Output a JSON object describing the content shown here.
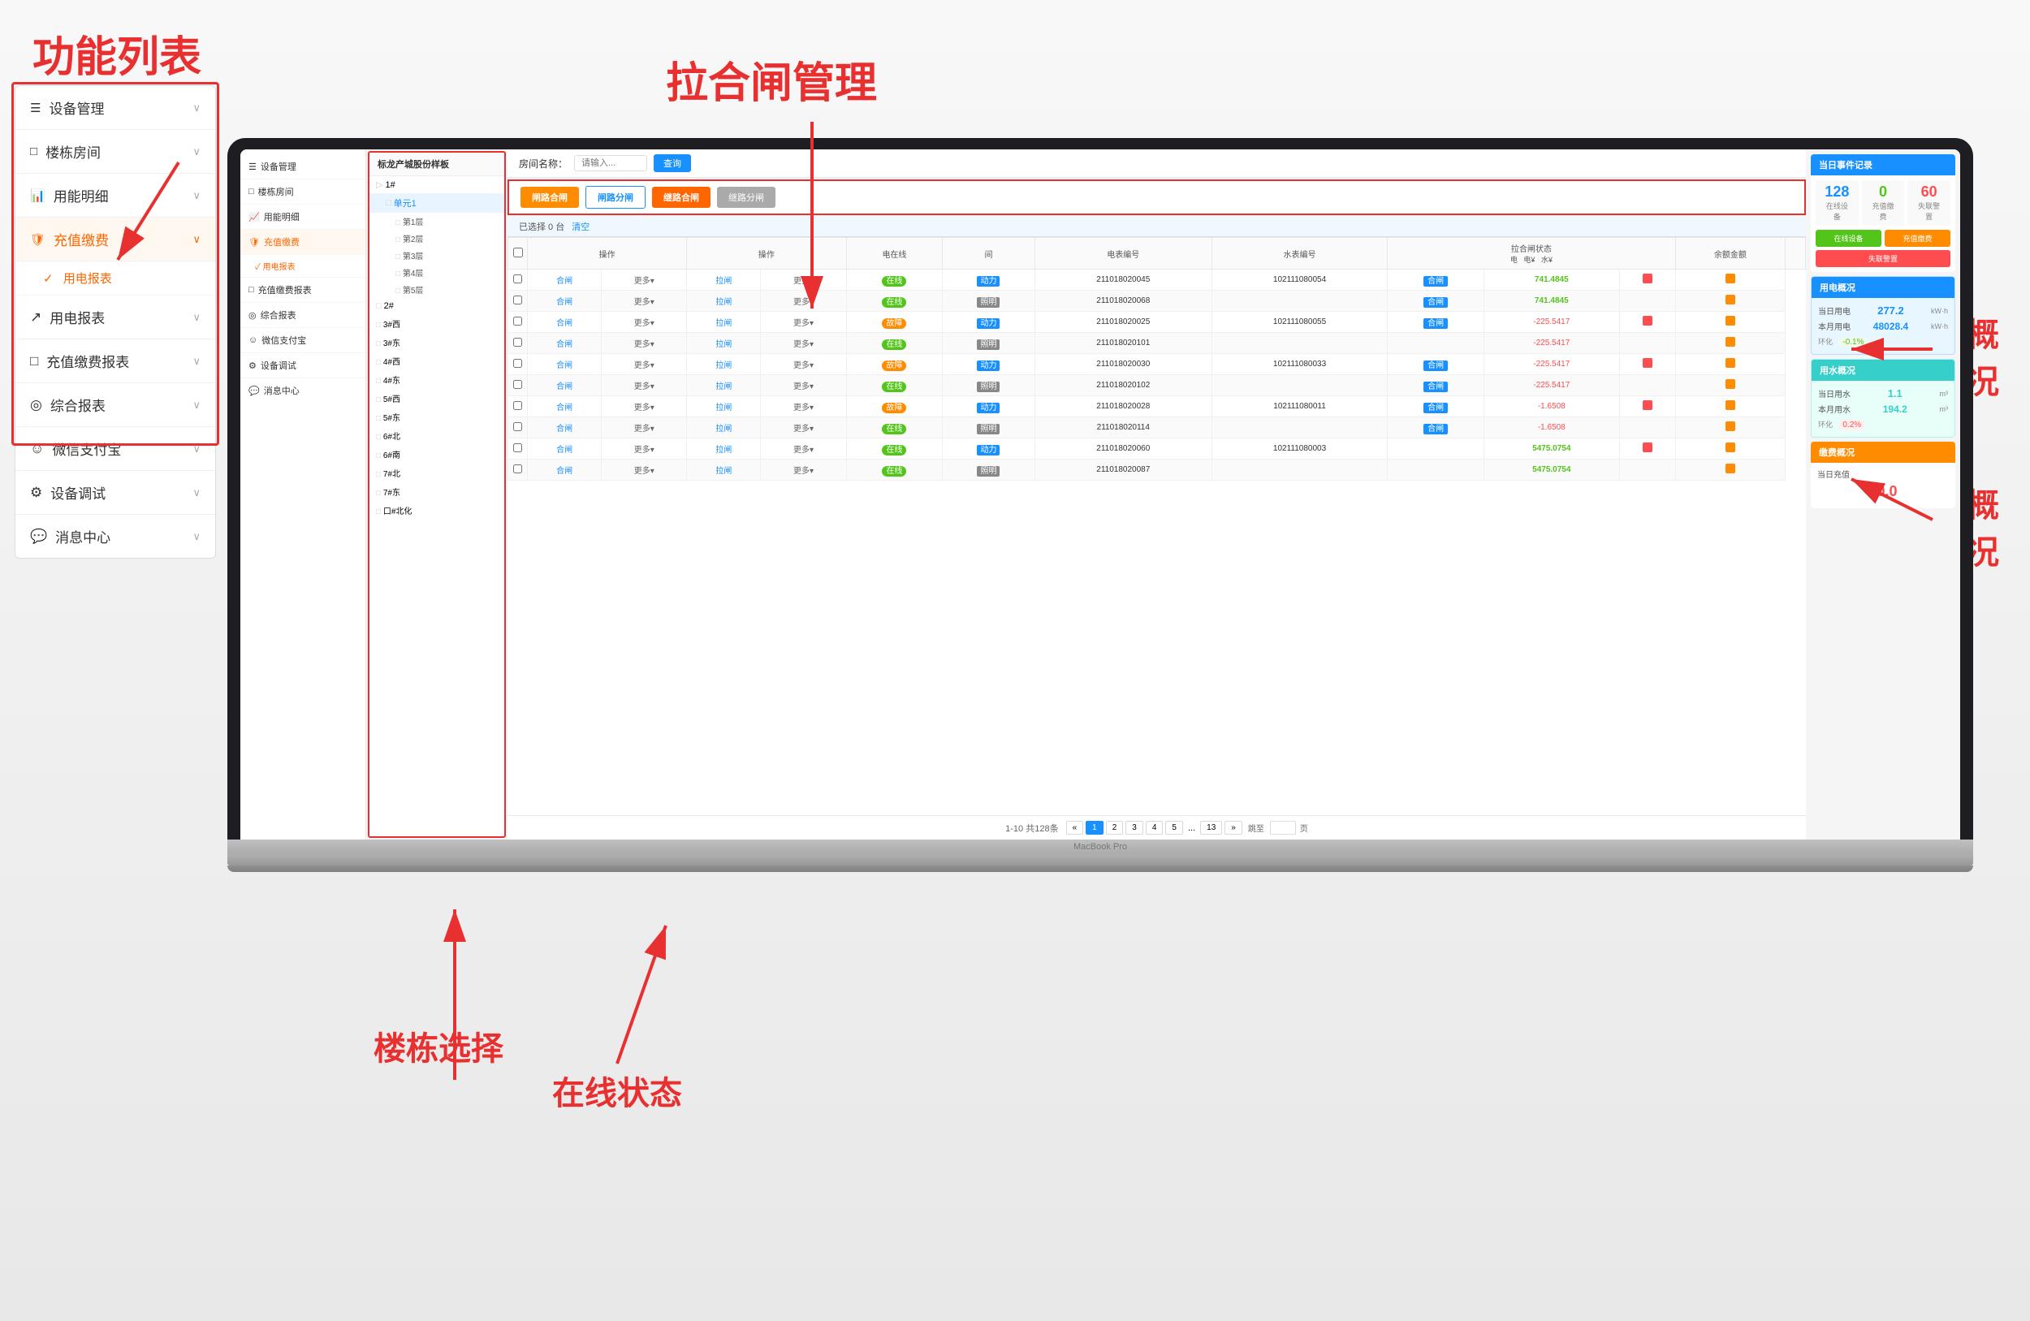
{
  "annotations": {
    "functional_list": "功能列表",
    "gate_management": "拉合闸管理",
    "electricity_overview": "用电概\n况",
    "water_overview": "用水概\n况",
    "building_select": "楼栋选择",
    "online_status": "在线状态"
  },
  "left_sidebar": {
    "title": "功能列表",
    "items": [
      {
        "id": "device-mgmt",
        "icon": "☰",
        "label": "设备管理",
        "has_chevron": true
      },
      {
        "id": "building-room",
        "icon": "□",
        "label": "楼栋房间",
        "has_chevron": true
      },
      {
        "id": "energy-detail",
        "icon": "📊",
        "label": "用能明细",
        "has_chevron": true
      },
      {
        "id": "recharge",
        "icon": "🛡",
        "label": "充值缴费",
        "has_chevron": true,
        "active": true
      },
      {
        "id": "sub1",
        "icon": "✓",
        "label": "用电报表",
        "is_sub": true
      },
      {
        "id": "electricity-report",
        "icon": "↗",
        "label": "用电报表",
        "has_chevron": true
      },
      {
        "id": "recharge-report",
        "icon": "□",
        "label": "充值缴费报表",
        "has_chevron": true
      },
      {
        "id": "comprehensive",
        "icon": "◎",
        "label": "综合报表",
        "has_chevron": true
      },
      {
        "id": "wechat-pay",
        "icon": "☺",
        "label": "微信支付宝",
        "has_chevron": true
      },
      {
        "id": "device-debug",
        "icon": "⚙",
        "label": "设备调试",
        "has_chevron": true
      },
      {
        "id": "message-center",
        "icon": "💬",
        "label": "消息中心",
        "has_chevron": true
      }
    ]
  },
  "inner_sidebar": {
    "items": [
      {
        "id": "device",
        "icon": "☰",
        "label": "设备管理"
      },
      {
        "id": "building",
        "icon": "□",
        "label": "楼栋房间"
      },
      {
        "id": "energy",
        "icon": "📈",
        "label": "用能明细"
      },
      {
        "id": "recharge-active",
        "icon": "🛡",
        "label": "充值缴费",
        "active": true
      },
      {
        "id": "ele-sub",
        "icon": "✓",
        "label": "用电报表",
        "is_sub": true,
        "active": true
      },
      {
        "id": "report",
        "icon": "□",
        "label": "充值缴费报表"
      },
      {
        "id": "comprehensive2",
        "icon": "◎",
        "label": "综合报表"
      },
      {
        "id": "wechat",
        "icon": "☺",
        "label": "微信支付宝"
      },
      {
        "id": "debug",
        "icon": "⚙",
        "label": "设备调试"
      },
      {
        "id": "message",
        "icon": "💬",
        "label": "消息中心"
      }
    ]
  },
  "tree_panel": {
    "header": "标龙产城股份样板",
    "items": [
      {
        "id": "1f",
        "label": "1#",
        "level": 0
      },
      {
        "id": "unit1",
        "label": "单元1",
        "level": 1,
        "selected": true
      },
      {
        "id": "f1",
        "label": "第1层",
        "level": 2
      },
      {
        "id": "f2",
        "label": "第2层",
        "level": 2
      },
      {
        "id": "f3",
        "label": "第3层",
        "level": 2
      },
      {
        "id": "f4",
        "label": "第4层",
        "level": 2
      },
      {
        "id": "f5",
        "label": "第5层",
        "level": 2
      },
      {
        "id": "2f",
        "label": "2#",
        "level": 0
      },
      {
        "id": "3w",
        "label": "3#西",
        "level": 0
      },
      {
        "id": "3e",
        "label": "3#东",
        "level": 0
      },
      {
        "id": "4s",
        "label": "4#西",
        "level": 0
      },
      {
        "id": "4e",
        "label": "4#东",
        "level": 0
      },
      {
        "id": "5w",
        "label": "5#西",
        "level": 0
      },
      {
        "id": "5e",
        "label": "5#东",
        "level": 0
      },
      {
        "id": "6n",
        "label": "6#北",
        "level": 0
      },
      {
        "id": "6m",
        "label": "6#南",
        "level": 0
      },
      {
        "id": "7n",
        "label": "7#北",
        "level": 0
      },
      {
        "id": "7e",
        "label": "7#东",
        "level": 0
      },
      {
        "id": "7-3",
        "label": "口#北化",
        "level": 0
      }
    ]
  },
  "search_bar": {
    "room_label": "房间名称：",
    "placeholder": "请输入...",
    "search_btn": "查询"
  },
  "gate_buttons": [
    {
      "id": "close-gate",
      "label": "闸路合闸",
      "class": "orange"
    },
    {
      "id": "open-gate",
      "label": "闸路分闸",
      "class": "blue-outline"
    },
    {
      "id": "restart-gate",
      "label": "继路合闸",
      "class": "orange2"
    },
    {
      "id": "reset-gate",
      "label": "继路分闸",
      "class": "gray"
    }
  ],
  "selection_info": {
    "text": "已选择 0 台",
    "clear": "清空"
  },
  "table": {
    "columns": [
      "操作",
      "操作",
      "电在线",
      "间",
      "电表编号",
      "水表编号",
      "拉合闸状态\n电",
      "拉合闸状态\n电¥",
      "拉合闸状态\n水¥",
      "",
      ""
    ],
    "rows": [
      {
        "op1": "合闸",
        "op2": "更多▾",
        "op3": "拉闸",
        "op4": "更多▾",
        "online": "在线",
        "type": "动力",
        "meter_id": "211018020045",
        "water_id": "102111080054",
        "elec_status": "合闸",
        "elec_val": "741.4845",
        "water_val": "■",
        "extra": "■"
      },
      {
        "op1": "合闸",
        "op2": "更多▾",
        "op3": "拉闸",
        "op4": "更多▾",
        "online": "在线",
        "type": "照明",
        "meter_id": "211018020068",
        "water_id": "",
        "elec_status": "合闸",
        "elec_val": "741.4845",
        "water_val": "",
        "extra": "■"
      },
      {
        "op1": "合闸",
        "op2": "更多▾",
        "op3": "拉闸",
        "op4": "更多▾",
        "online": "故障",
        "type": "动力",
        "meter_id": "211018020025",
        "water_id": "102111080055",
        "elec_status": "合闸",
        "elec_val": "-225.5417",
        "water_val": "■",
        "extra": "■"
      },
      {
        "op1": "合闸",
        "op2": "更多▾",
        "op3": "拉闸",
        "op4": "更多▾",
        "online": "在线",
        "type": "照明",
        "meter_id": "211018020101",
        "water_id": "",
        "elec_status": "",
        "elec_val": "-225.5417",
        "water_val": "",
        "extra": "■"
      },
      {
        "op1": "合闸",
        "op2": "更多▾",
        "op3": "拉闸",
        "op4": "更多▾",
        "online": "故障",
        "type": "动力",
        "meter_id": "211018020030",
        "water_id": "102111080033",
        "elec_status": "合闸",
        "elec_val": "-225.5417",
        "water_val": "■",
        "extra": "■"
      },
      {
        "op1": "合闸",
        "op2": "更多▾",
        "op3": "拉闸",
        "op4": "更多▾",
        "online": "在线",
        "type": "照明",
        "meter_id": "211018020102",
        "water_id": "",
        "elec_status": "合闸",
        "elec_val": "-225.5417",
        "water_val": "",
        "extra": "■"
      },
      {
        "op1": "合闸",
        "op2": "更多▾",
        "op3": "拉闸",
        "op4": "更多▾",
        "online": "故障",
        "type": "动力",
        "meter_id": "211018020028",
        "water_id": "102111080011",
        "elec_status": "合闸",
        "elec_val": "-1.6508",
        "water_val": "■",
        "extra": "■"
      },
      {
        "op1": "合闸",
        "op2": "更多▾",
        "op3": "拉闸",
        "op4": "更多▾",
        "online": "在线",
        "type": "照明",
        "meter_id": "211018020114",
        "water_id": "",
        "elec_status": "合闸",
        "elec_val": "-1.6508",
        "water_val": "",
        "extra": "■"
      },
      {
        "op1": "合闸",
        "op2": "更多▾",
        "op3": "拉闸",
        "op4": "更多▾",
        "online": "在线",
        "type": "动力",
        "meter_id": "211018020060",
        "water_id": "102111080003",
        "elec_status": "",
        "elec_val": "5475.0754",
        "water_val": "■",
        "extra": "■"
      },
      {
        "op1": "合闸",
        "op2": "更多▾",
        "op3": "拉闸",
        "op4": "更多▾",
        "online": "在线",
        "type": "照明",
        "meter_id": "211018020087",
        "water_id": "",
        "elec_status": "",
        "elec_val": "5475.0754",
        "water_val": "",
        "extra": "■"
      }
    ]
  },
  "pagination": {
    "total": "1-10 共128条",
    "pages": [
      "1",
      "2",
      "3",
      "4",
      "5",
      "...",
      "13"
    ],
    "jump_label": "跳至",
    "page_unit": "页"
  },
  "right_panel": {
    "event_log": {
      "title": "当日事件记录",
      "stats": [
        {
          "label": "在线设\n备",
          "count": "128",
          "color": "blue"
        },
        {
          "label": "充值缴\n费",
          "count": "0",
          "color": "green"
        },
        {
          "label": "失联警\n置",
          "count": "60",
          "color": "red"
        }
      ],
      "event_types": [
        {
          "label": "在线设备",
          "color": "green"
        },
        {
          "label": "充值缴费",
          "color": "orange"
        },
        {
          "label": "失联警置",
          "color": "red"
        }
      ]
    },
    "electricity": {
      "title": "用电概况",
      "today_label": "当日用电",
      "today_value": "277.2",
      "today_unit": "kW·h",
      "month_label": "本月用电",
      "month_value": "48028.4",
      "month_unit": "kW·h",
      "change_label": "环化",
      "change_value": "-0.1%",
      "change_type": "down"
    },
    "water": {
      "title": "用水概况",
      "today_label": "当日用水",
      "today_value": "1.1",
      "today_unit": "m³",
      "month_label": "本月用水",
      "month_value": "194.2",
      "month_unit": "m³",
      "change_label": "环化",
      "change_value": "0.2%",
      "change_type": "up"
    },
    "charge": {
      "title": "缴费概况",
      "today_label": "当日充值",
      "today_value": "¥0.0"
    }
  }
}
